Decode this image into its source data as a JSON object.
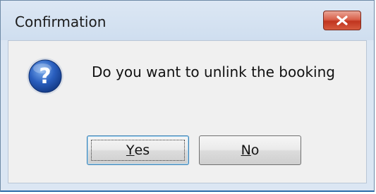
{
  "window": {
    "title": "Confirmation"
  },
  "icons": {
    "close": "close-icon",
    "question": "question-icon"
  },
  "message": "Do you want to unlink the booking",
  "buttons": {
    "yes": {
      "mnemonic": "Y",
      "rest": "es"
    },
    "no": {
      "mnemonic": "N",
      "rest": "o"
    }
  },
  "colors": {
    "close_button": "#c9452c",
    "question_icon": "#1f4fa8",
    "focus_border": "#3c7fb1"
  }
}
